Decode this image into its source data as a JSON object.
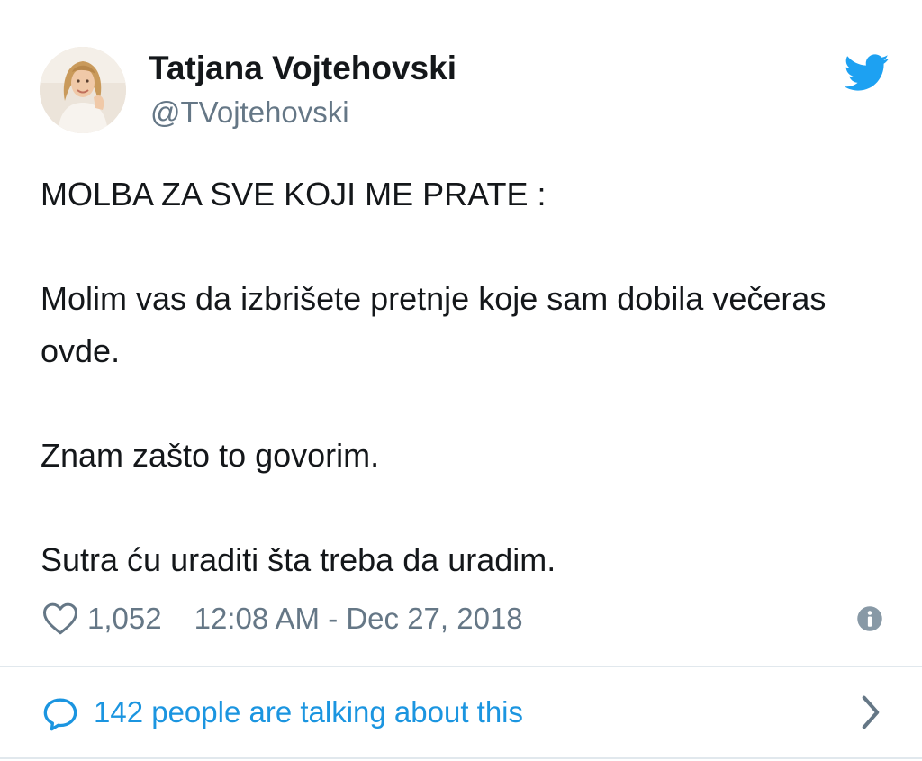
{
  "author": {
    "display_name": "Tatjana Vojtehovski",
    "handle": "@TVojtehovski"
  },
  "icons": {
    "avatar": "profile-photo",
    "brand": "twitter-bird-icon",
    "like": "heart-icon",
    "info": "info-icon",
    "replies": "speech-bubble-icon",
    "more": "chevron-right-icon"
  },
  "tweet": {
    "paragraphs": [
      "MOLBA ZA SVE KOJI ME PRATE :",
      "Molim vas da izbrišete pretnje koje sam dobila večeras ovde.",
      "Znam zašto to govorim.",
      "Sutra ću uraditi šta treba da uradim."
    ],
    "like_count": "1,052",
    "timestamp": "12:08 AM - Dec 27, 2018"
  },
  "conversation": {
    "label": "142 people are talking about this"
  },
  "colors": {
    "brand_blue": "#1da1f2",
    "link_blue": "#1b95e0",
    "secondary_text": "#657786",
    "primary_text": "#14171a",
    "divider": "#e1e8ed"
  }
}
